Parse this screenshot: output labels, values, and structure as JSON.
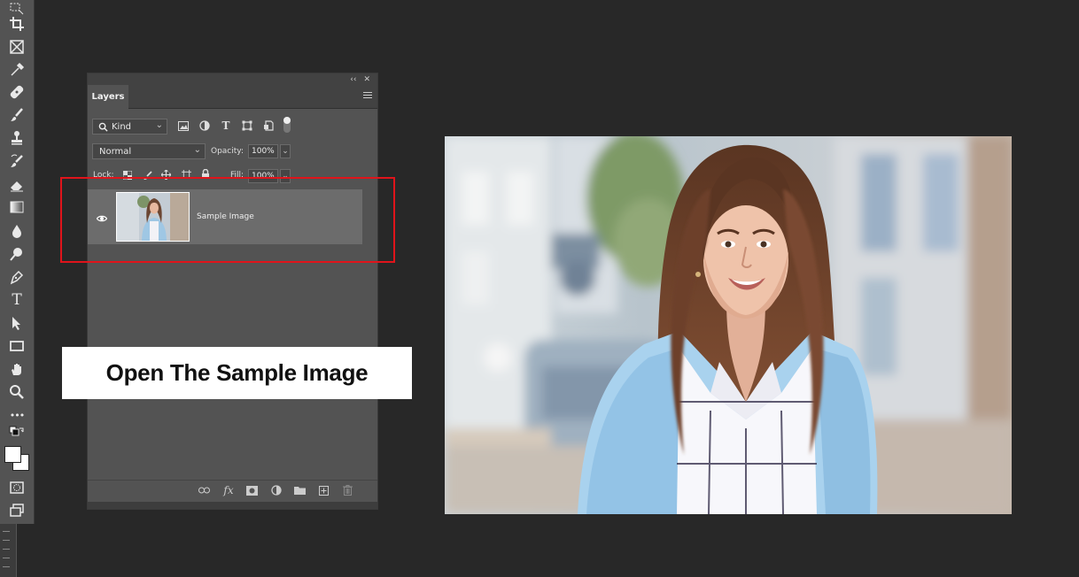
{
  "toolbar": {
    "tools": [
      "marquee-tool",
      "crop-tool",
      "frame-tool",
      "eyedropper-tool",
      "healing-brush-tool",
      "brush-tool",
      "clone-stamp-tool",
      "history-brush-tool",
      "eraser-tool",
      "gradient-tool",
      "blur-tool",
      "dodge-tool",
      "pen-tool",
      "type-tool",
      "path-selection-tool",
      "rectangle-tool",
      "hand-tool",
      "zoom-tool",
      "more-tools"
    ],
    "type_glyph": "T",
    "more_glyph": "•••"
  },
  "layers_panel": {
    "collapse_glyph": "‹‹",
    "close_glyph": "✕",
    "tab_label": "Layers",
    "filter": {
      "kind_label": "Kind",
      "type_glyph": "T"
    },
    "blend_mode": "Normal",
    "opacity_label": "Opacity:",
    "opacity_value": "100%",
    "lock_label": "Lock:",
    "fill_label": "Fill:",
    "fill_value": "100%",
    "layers": [
      {
        "name": "Sample Image",
        "visible": true
      }
    ],
    "footer": {
      "fx_label": "fx"
    }
  },
  "annotation": {
    "caption": "Open The Sample Image",
    "highlight_color": "#e0141b"
  },
  "colors": {
    "background": "#282828",
    "panel": "#535353",
    "selected_layer": "#6c6c6c"
  }
}
